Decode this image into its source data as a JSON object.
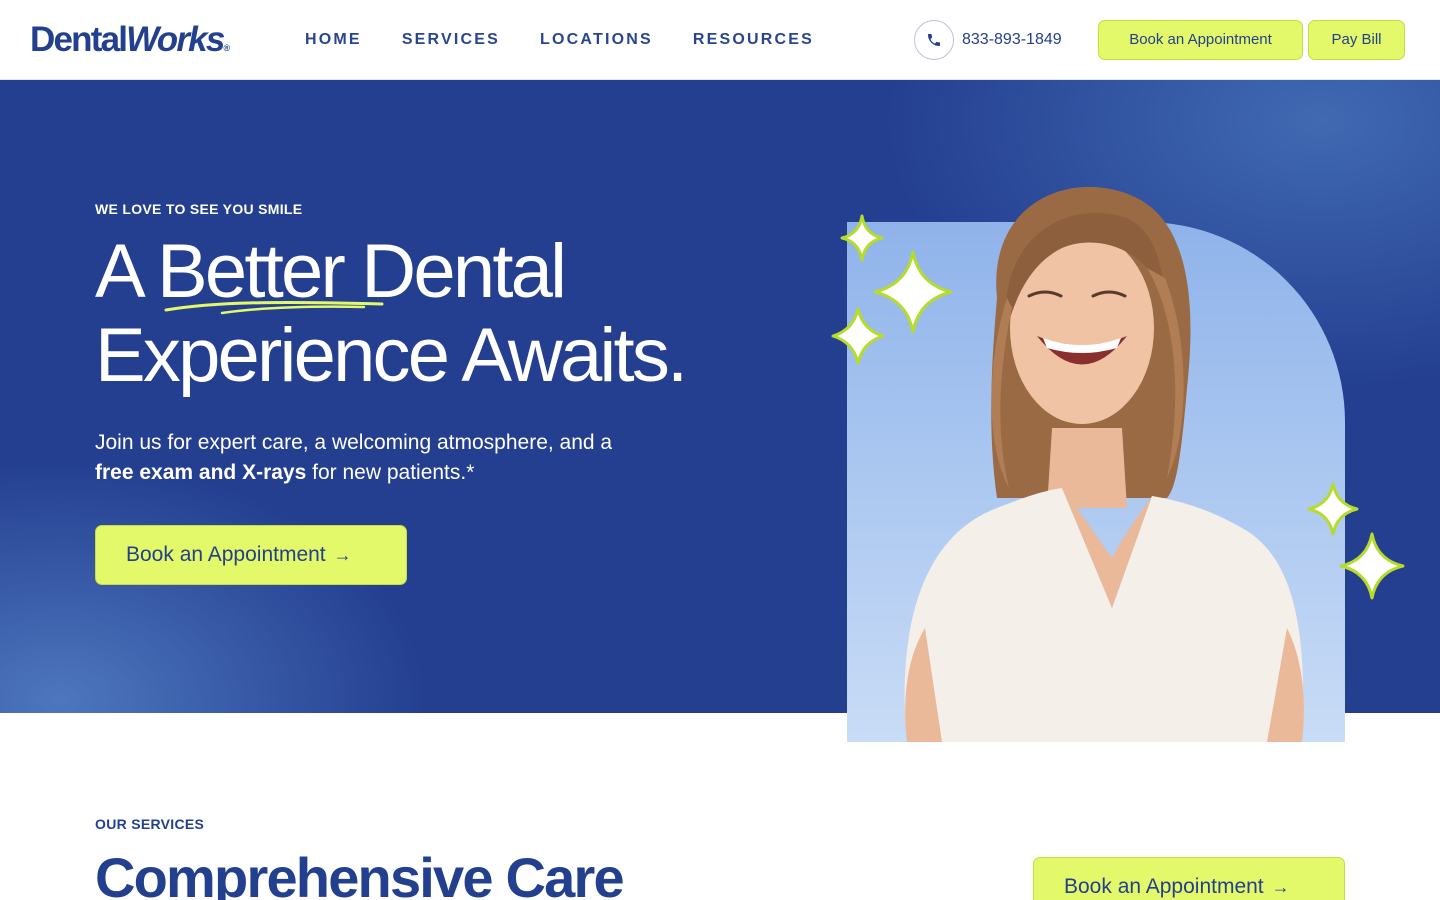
{
  "brand": {
    "name_part1": "Dental",
    "name_part2": "Works",
    "registered": "®"
  },
  "nav": {
    "items": [
      "HOME",
      "SERVICES",
      "LOCATIONS",
      "RESOURCES"
    ]
  },
  "header": {
    "phone": "833-893-1849",
    "book_label": "Book an Appointment",
    "pay_label": "Pay Bill"
  },
  "hero": {
    "eyebrow": "WE LOVE TO SEE YOU SMILE",
    "headline_word1": "A ",
    "headline_word2": "Better",
    "headline_word3": " Dental",
    "headline_line2": "Experience Awaits.",
    "sub_line1": "Join us for expert care, a welcoming atmosphere, and a",
    "sub_bold": "free exam and X-rays",
    "sub_rest": " for new patients.*",
    "cta_label": "Book an Appointment",
    "cta_arrow": "→"
  },
  "services": {
    "eyebrow": "OUR SERVICES",
    "title": "Comprehensive Care",
    "cta_label": "Book an Appointment",
    "cta_arrow": "→"
  },
  "colors": {
    "brand_blue": "#23408e",
    "hero_blue": "#243f90",
    "accent_lime": "#e4f96a",
    "sparkle_green": "#b6dc2a"
  },
  "icons": [
    "phone-icon",
    "arrow-right-icon",
    "sparkle-icon"
  ]
}
